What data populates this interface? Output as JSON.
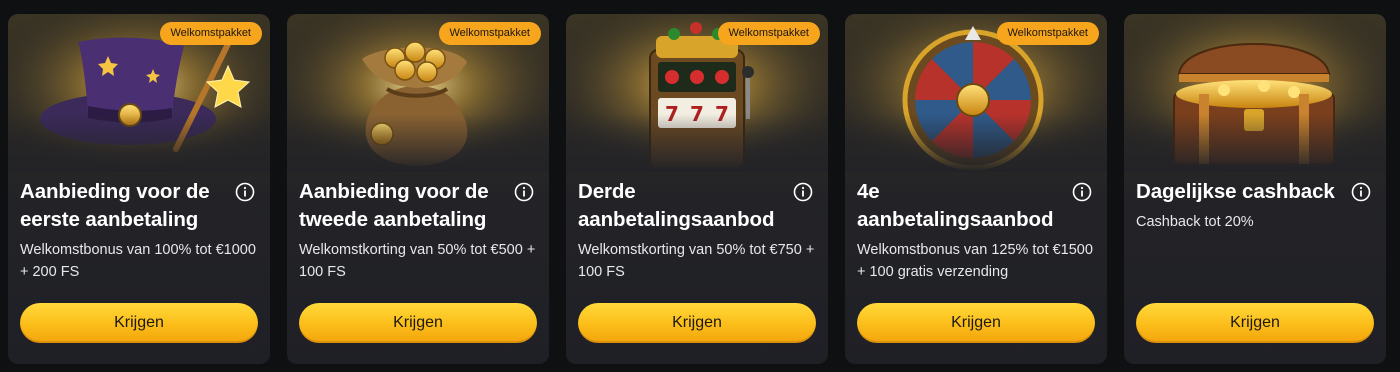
{
  "offers": [
    {
      "badge": "Welkomstpakket",
      "title": "Aanbieding voor de eerste aanbetaling",
      "description": "Welkomstbonus van 100% tot €1000 + 200 FS",
      "button": "Krijgen",
      "illustration": "wizard-hat-icon"
    },
    {
      "badge": "Welkomstpakket",
      "title": "Aanbieding voor de tweede aanbetaling",
      "description": "Welkomstkorting van 50% tot €500 + 100 FS",
      "button": "Krijgen",
      "illustration": "coin-sack-icon"
    },
    {
      "badge": "Welkomstpakket",
      "title": "Derde aanbetalingsaanbod",
      "description": "Welkomstkorting van 50% tot €750 + 100 FS",
      "button": "Krijgen",
      "illustration": "slot-machine-icon"
    },
    {
      "badge": "Welkomstpakket",
      "title": "4e aanbetalingsaanbod",
      "description": "Welkomstbonus van 125% tot €1500 + 100 gratis verzending",
      "button": "Krijgen",
      "illustration": "fortune-wheel-icon"
    },
    {
      "title": "Dagelijkse cashback",
      "description": "Cashback tot 20%",
      "button": "Krijgen",
      "illustration": "treasure-chest-icon"
    }
  ],
  "colors": {
    "badge": "#f7a51d",
    "button": "#fbbd19",
    "card": "#232327",
    "page": "#0f1012"
  }
}
